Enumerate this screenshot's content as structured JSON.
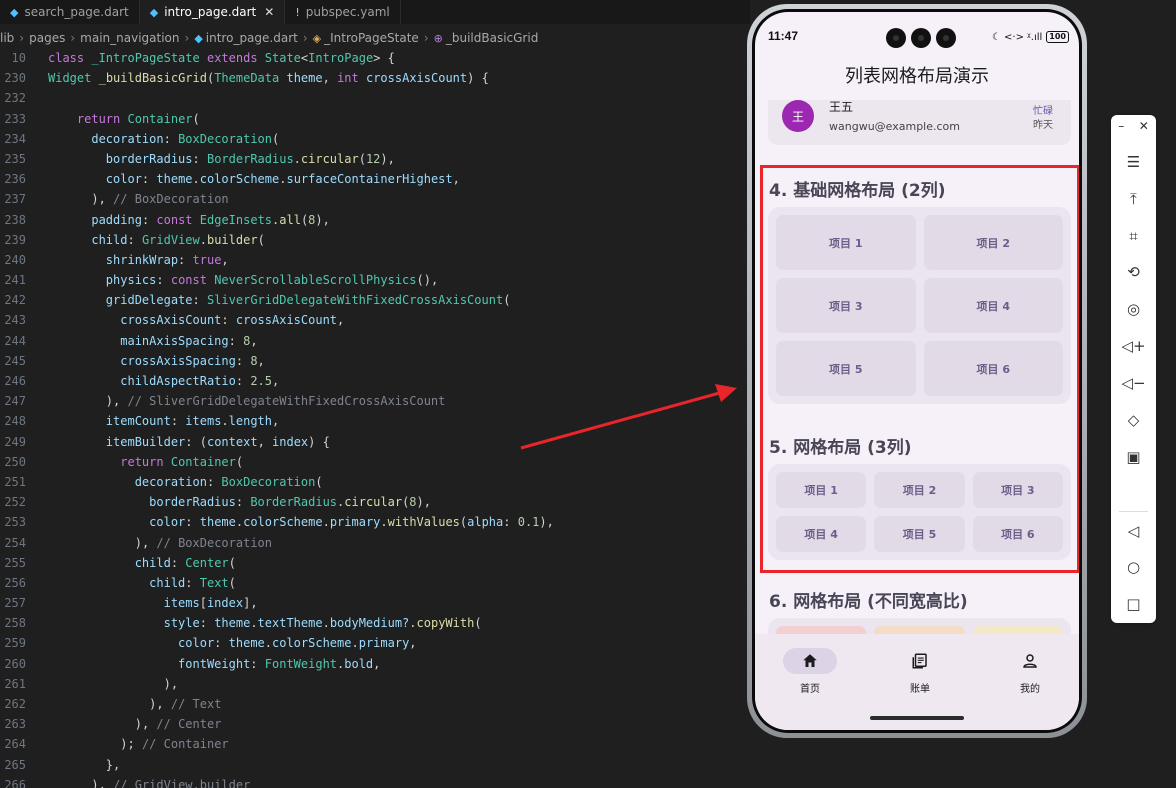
{
  "editor": {
    "tabs": [
      {
        "label": "search_page.dart",
        "icon": "dart-file-icon",
        "active": false
      },
      {
        "label": "intro_page.dart",
        "icon": "dart-file-icon",
        "active": true
      },
      {
        "label": "pubspec.yaml",
        "icon": "yaml-file-icon",
        "active": false
      }
    ],
    "breadcrumb": [
      "lib",
      "pages",
      "main_navigation",
      "intro_page.dart",
      "_IntroPageState",
      "_buildBasicGrid"
    ],
    "sticky_lines": [
      {
        "num": "10",
        "text": "class _IntroPageState extends State<IntroPage> {"
      },
      {
        "num": "230",
        "text": "Widget _buildBasicGrid(ThemeData theme, int crossAxisCount) {"
      }
    ],
    "lines": [
      {
        "num": "232",
        "text": "      "
      },
      {
        "num": "233",
        "text": "    return Container("
      },
      {
        "num": "234",
        "text": "      decoration: BoxDecoration("
      },
      {
        "num": "235",
        "text": "        borderRadius: BorderRadius.circular(12),"
      },
      {
        "num": "236",
        "text": "        color: theme.colorScheme.surfaceContainerHighest,"
      },
      {
        "num": "237",
        "text": "      ), // BoxDecoration"
      },
      {
        "num": "238",
        "text": "      padding: const EdgeInsets.all(8),"
      },
      {
        "num": "239",
        "text": "      child: GridView.builder("
      },
      {
        "num": "240",
        "text": "        shrinkWrap: true,"
      },
      {
        "num": "241",
        "text": "        physics: const NeverScrollableScrollPhysics(),"
      },
      {
        "num": "242",
        "text": "        gridDelegate: SliverGridDelegateWithFixedCrossAxisCount("
      },
      {
        "num": "243",
        "text": "          crossAxisCount: crossAxisCount,"
      },
      {
        "num": "244",
        "text": "          mainAxisSpacing: 8,"
      },
      {
        "num": "245",
        "text": "          crossAxisSpacing: 8,"
      },
      {
        "num": "246",
        "text": "          childAspectRatio: 2.5,"
      },
      {
        "num": "247",
        "text": "        ), // SliverGridDelegateWithFixedCrossAxisCount"
      },
      {
        "num": "248",
        "text": "        itemCount: items.length,"
      },
      {
        "num": "249",
        "text": "        itemBuilder: (context, index) {"
      },
      {
        "num": "250",
        "text": "          return Container("
      },
      {
        "num": "251",
        "text": "            decoration: BoxDecoration("
      },
      {
        "num": "252",
        "text": "              borderRadius: BorderRadius.circular(8),"
      },
      {
        "num": "253",
        "text": "              color: theme.colorScheme.primary.withValues(alpha: 0.1),"
      },
      {
        "num": "254",
        "text": "            ), // BoxDecoration"
      },
      {
        "num": "255",
        "text": "            child: Center("
      },
      {
        "num": "256",
        "text": "              child: Text("
      },
      {
        "num": "257",
        "text": "                items[index],"
      },
      {
        "num": "258",
        "text": "                style: theme.textTheme.bodyMedium?.copyWith("
      },
      {
        "num": "259",
        "text": "                  color: theme.colorScheme.primary,"
      },
      {
        "num": "260",
        "text": "                  fontWeight: FontWeight.bold,"
      },
      {
        "num": "261",
        "text": "                ),"
      },
      {
        "num": "262",
        "text": "              ), // Text"
      },
      {
        "num": "263",
        "text": "            ), // Center"
      },
      {
        "num": "264",
        "text": "          ); // Container"
      },
      {
        "num": "265",
        "text": "        },"
      },
      {
        "num": "266",
        "text": "      ), // GridView.builder"
      }
    ]
  },
  "phone": {
    "status": {
      "time": "11:47",
      "icons": "☾ <·> ᵡ.ıll",
      "battery": "100"
    },
    "appbar_title": "列表网格布局演示",
    "list_item": {
      "avatar": "王",
      "name": "王五",
      "email": "wangwu@example.com",
      "status": "忙碌",
      "time": "昨天"
    },
    "section4": {
      "title": "4. 基础网格布局 (2列)",
      "items": [
        "项目 1",
        "项目 2",
        "项目 3",
        "项目 4",
        "项目 5",
        "项目 6"
      ]
    },
    "section5": {
      "title": "5. 网格布局 (3列)",
      "items": [
        "项目 1",
        "项目 2",
        "项目 3",
        "项目 4",
        "项目 5",
        "项目 6"
      ]
    },
    "section6": {
      "title": "6. 网格布局 (不同宽高比)",
      "colors": [
        "#f2d0d2",
        "#f4dcc6",
        "#f3e9c8"
      ]
    },
    "nav": [
      {
        "label": "首页",
        "icon": "home-icon",
        "active": true
      },
      {
        "label": "账单",
        "icon": "bill-icon",
        "active": false
      },
      {
        "label": "我的",
        "icon": "profile-icon",
        "active": false
      }
    ]
  },
  "colors": {
    "highlight_box": "#e8252a",
    "arrow": "#e8252a",
    "primary": "#6750a4"
  }
}
